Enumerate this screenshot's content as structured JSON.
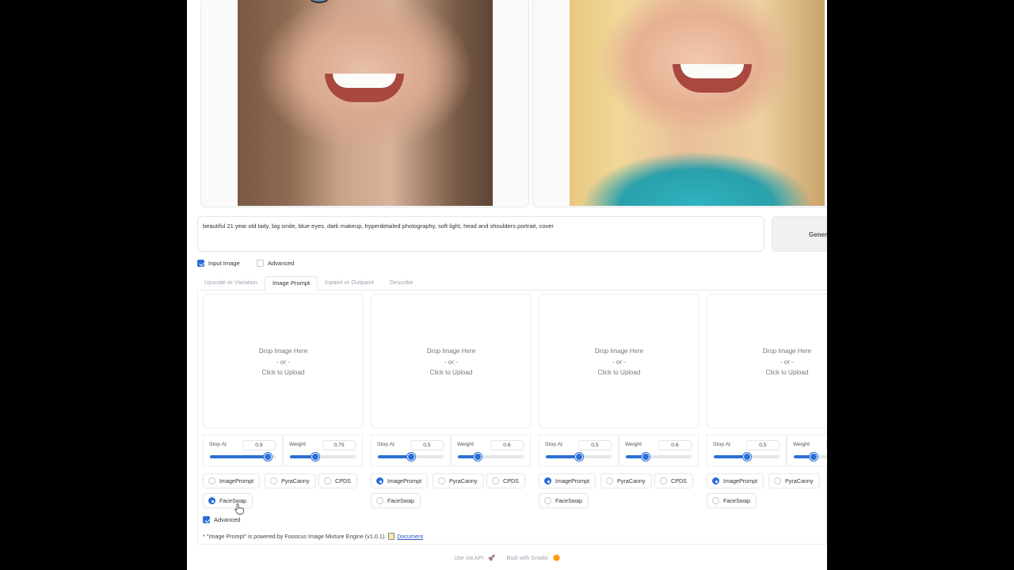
{
  "prompt": {
    "value": "beautiful 21 year old lady, big smile, blue eyes, dark makeup, hyperdetailed photography, soft light, head and shoulders portrait, cover"
  },
  "generate_label": "Gener",
  "checkboxes": {
    "input_image": {
      "label": "Input Image",
      "checked": true
    },
    "advanced_top": {
      "label": "Advanced",
      "checked": false
    },
    "advanced_bottom": {
      "label": "Advanced",
      "checked": true
    }
  },
  "tabs": [
    {
      "label": "Upscale or Variation",
      "active": false
    },
    {
      "label": "Image Prompt",
      "active": true
    },
    {
      "label": "Inpaint or Outpaint",
      "active": false
    },
    {
      "label": "Describe",
      "active": false
    }
  ],
  "upload": {
    "line1": "Drop Image Here",
    "line2": "- or -",
    "line3": "Click to Upload"
  },
  "slider_labels": {
    "stop_at": "Stop At",
    "weight": "Weight"
  },
  "columns": [
    {
      "stop_at": "0.9",
      "weight": "0.75",
      "selected": "FaceSwap"
    },
    {
      "stop_at": "0.5",
      "weight": "0.6",
      "selected": "ImagePrompt"
    },
    {
      "stop_at": "0.5",
      "weight": "0.6",
      "selected": "ImagePrompt"
    },
    {
      "stop_at": "0.5",
      "weight": "",
      "selected": "ImagePrompt"
    }
  ],
  "radio_options": [
    "ImagePrompt",
    "PyraCanny",
    "CPDS",
    "FaceSwap"
  ],
  "note": {
    "text": "* \"Image Prompt\" is powered by Fooocus Image Mixture Engine (v1.0.1).",
    "link": "Document"
  },
  "footer": {
    "api": "Use via API",
    "built": "Built with Gradio"
  },
  "colors": {
    "accent": "#2b6fd6"
  }
}
